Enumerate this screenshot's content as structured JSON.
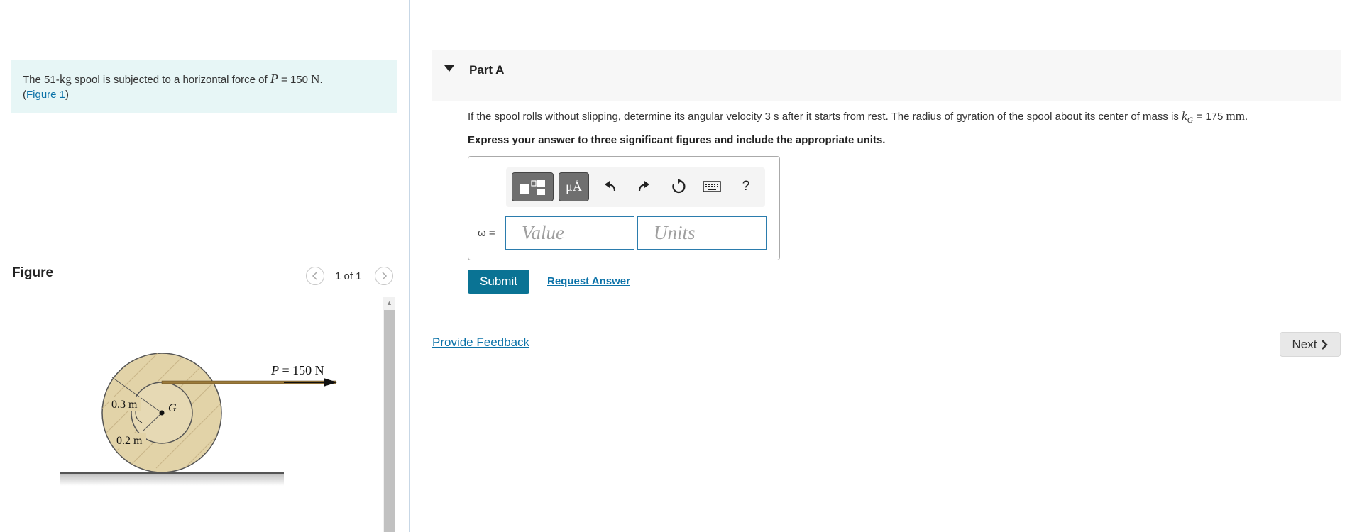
{
  "problem": {
    "text_pre": "The 51-",
    "mass_unit": "kg",
    "text_mid": " spool is subjected to a horizontal force of ",
    "force_var": "P",
    "force_eq": " = 150 ",
    "force_unit": "N",
    "text_end": ".",
    "link_open": "(",
    "figure_link": "Figure 1",
    "link_close": ")"
  },
  "figure": {
    "title": "Figure",
    "counter": "1 of 1",
    "prev_icon": "chevron-left-icon",
    "next_icon": "chevron-right-icon",
    "force_label_var": "P",
    "force_label_rest": " = 150 N",
    "outer_radius": "0.3 m",
    "inner_radius": "0.2 m",
    "center_label": "G"
  },
  "part_a": {
    "title": "Part A",
    "question_pre": "If the spool rolls without slipping, determine its angular velocity 3 s after it starts from rest. The radius of gyration of the spool about its center of mass is ",
    "k_var": "k",
    "k_sub": "G",
    "k_eq": " = 175 ",
    "k_unit": "mm",
    "k_end": ".",
    "instruction": "Express your answer to three significant figures and include the appropriate units.",
    "toolbar": {
      "templates_icon": "templates-icon",
      "units_label": "μÅ",
      "undo_icon": "undo-icon",
      "redo_icon": "redo-icon",
      "reset_icon": "reset-icon",
      "keyboard_icon": "keyboard-icon",
      "help_label": "?"
    },
    "answer_label": "ω =",
    "value_placeholder": "Value",
    "units_placeholder": "Units",
    "submit_label": "Submit",
    "request_label": "Request Answer"
  },
  "footer": {
    "feedback_label": "Provide Feedback",
    "next_label": "Next"
  },
  "colors": {
    "accent": "#0a7394",
    "link": "#0b72a8",
    "problem_bg": "#e7f6f6"
  }
}
